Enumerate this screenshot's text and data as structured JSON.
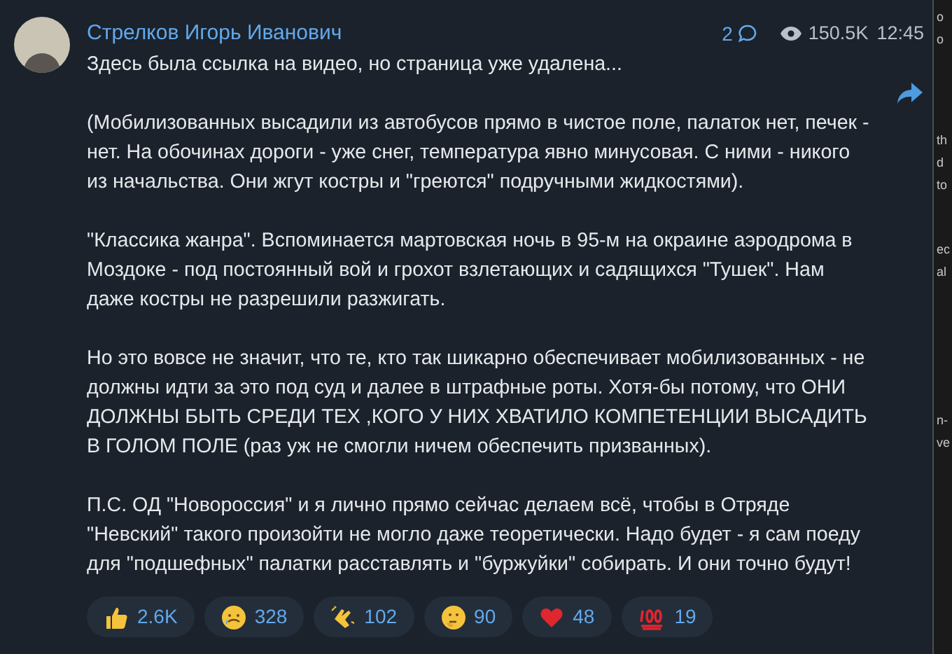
{
  "post": {
    "author": "Стрелков Игорь Иванович",
    "comments": "2",
    "views": "150.5K",
    "time": "12:45",
    "paragraphs": [
      "Здесь была ссылка на видео, но страница уже удалена...",
      "(Мобилизованных высадили из автобусов прямо в чистое поле, палаток нет, печек - нет. На обочинах дороги - уже снег, температура явно минусовая. С ними - никого из начальства. Они жгут костры и \"греются\" подручными жидкостями).",
      "\"Классика жанра\". Вспоминается мартовская ночь в 95-м на окраине аэродрома в Моздоке - под постоянный вой и грохот взлетающих и садящихся \"Тушек\". Нам даже костры не разрешили разжигать.",
      "Но это вовсе не значит, что те, кто так шикарно обеспечивает мобилизованных - не должны идти за это под суд и далее в штрафные роты. Хотя-бы потому, что ОНИ ДОЛЖНЫ БЫТЬ СРЕДИ ТЕХ ,КОГО У НИХ ХВАТИЛО КОМПЕТЕНЦИИ ВЫСАДИТЬ В ГОЛОМ ПОЛЕ (раз уж не смогли ничем обеспечить призванных).",
      "П.С. ОД \"Новороссия\" и я лично прямо сейчас делаем всё, чтобы в Отряде \"Невский\" такого произойти не могло даже теоретически. Надо будет - я сам поеду для \"подшефных\" палатки расставлять и \"буржуйки\" собирать. И они точно будут!"
    ],
    "reactions": [
      {
        "kind": "thumbs-up",
        "count": "2.6K"
      },
      {
        "kind": "crying",
        "count": "328"
      },
      {
        "kind": "clapping",
        "count": "102"
      },
      {
        "kind": "thinking",
        "count": "90"
      },
      {
        "kind": "heart",
        "count": "48"
      },
      {
        "kind": "hundred",
        "count": "19"
      }
    ]
  },
  "side_fragments": [
    [
      "o",
      "o"
    ],
    [
      "th",
      "d",
      "to"
    ],
    [
      "ec",
      "al"
    ],
    [
      "n-",
      "ve"
    ]
  ]
}
